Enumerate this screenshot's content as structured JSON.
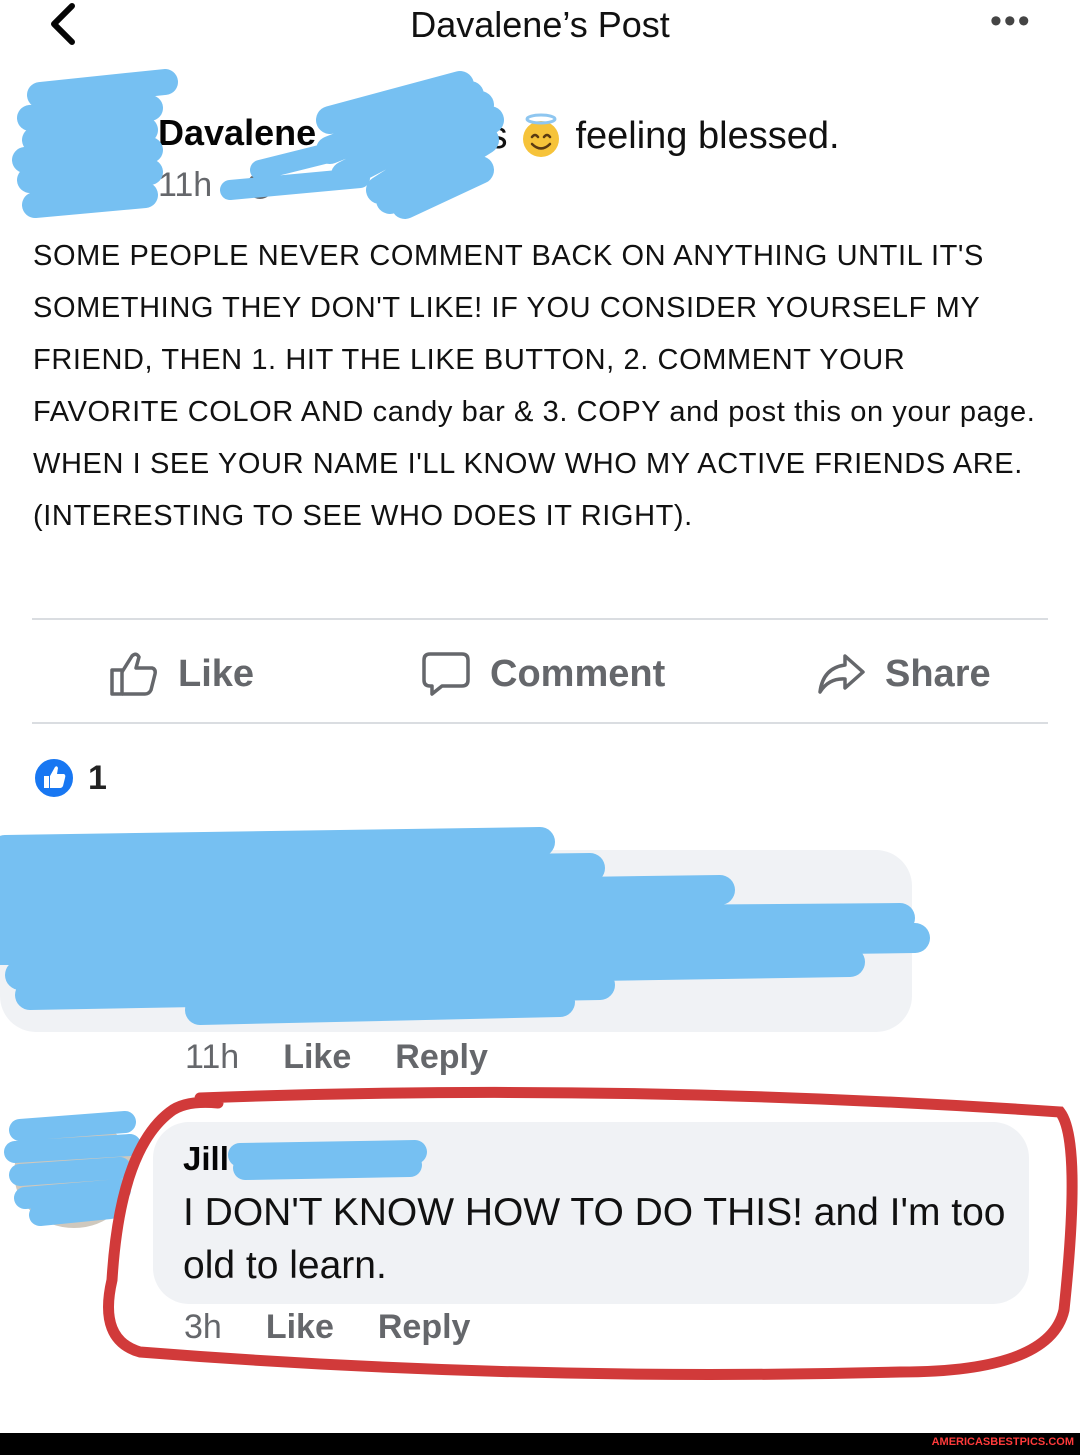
{
  "header": {
    "title": "Davalene’s Post",
    "back_icon": "chevron-left-icon",
    "more_label": "•••"
  },
  "post": {
    "author": "Davalene",
    "status_prefix": "is",
    "status": "feeling blessed.",
    "time": "11h",
    "dot": "·",
    "text": "SOME PEOPLE NEVER COMMENT BACK ON ANYTHING UNTIL IT'S SOMETHING THEY DON'T LIKE! IF YOU CONSIDER YOURSELF MY FRIEND, THEN 1. HIT THE LIKE BUTTON, 2. COMMENT YOUR FAVORITE COLOR AND candy bar & 3. COPY and post this on your page. WHEN I SEE YOUR NAME I'LL KNOW WHO MY ACTIVE FRIENDS ARE. (INTERESTING TO SEE WHO DOES IT RIGHT)."
  },
  "actions": {
    "like": "Like",
    "comment": "Comment",
    "share": "Share"
  },
  "reactions": {
    "count": "1"
  },
  "comments": [
    {
      "time": "11h",
      "like": "Like",
      "reply": "Reply"
    },
    {
      "author": "Jill",
      "text": "I DON'T KNOW HOW TO DO THIS!  and I'm too old to learn.",
      "time": "3h",
      "like": "Like",
      "reply": "Reply"
    }
  ],
  "footer": {
    "watermark": "AMERICASBESTPICS.COM"
  },
  "colors": {
    "redaction": "#76c0f2",
    "highlight_circle": "#d13a3a",
    "like_blue": "#1877f2",
    "muted_text": "#65676b",
    "bubble": "#f0f2f5"
  }
}
